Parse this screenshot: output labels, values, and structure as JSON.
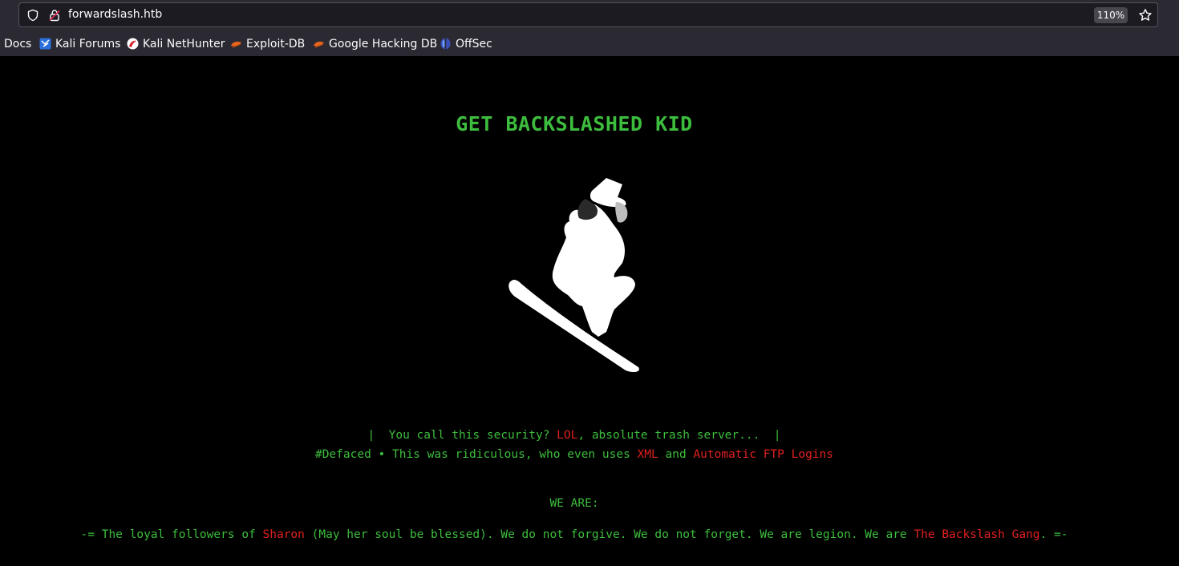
{
  "browser": {
    "url": "forwardslash.htb",
    "zoom": "110%",
    "bookmarks": [
      {
        "label": "Docs",
        "icon": "none"
      },
      {
        "label": "Kali Forums",
        "icon": "kali-forums-icon"
      },
      {
        "label": "Kali NetHunter",
        "icon": "kali-nethunter-icon"
      },
      {
        "label": "Exploit-DB",
        "icon": "exploit-db-icon"
      },
      {
        "label": "Google Hacking DB",
        "icon": "ghdb-icon"
      },
      {
        "label": "OffSec",
        "icon": "offsec-icon"
      }
    ]
  },
  "page": {
    "title": "GET BACKSLASHED KID",
    "image": "snowboarder-silhouette",
    "line1": {
      "a": "|  You call this security? ",
      "b": "LOL",
      "c": ", absolute trash server...  |"
    },
    "line2": {
      "a": "#Defaced • This was ridiculous, who even uses ",
      "b": "XML",
      "c": " and ",
      "d": "Automatic FTP Logins"
    },
    "we_are": "WE ARE:",
    "line3": {
      "a": "-= The loyal followers of ",
      "b": "Sharon",
      "c": " (May her soul be blessed). We do not forgive. We do not forget. We are legion. We are ",
      "d": "The Backslash Gang",
      "e": ". =-"
    }
  },
  "colors": {
    "green": "#3dbd3d",
    "red": "#e02020",
    "background": "#000000"
  }
}
